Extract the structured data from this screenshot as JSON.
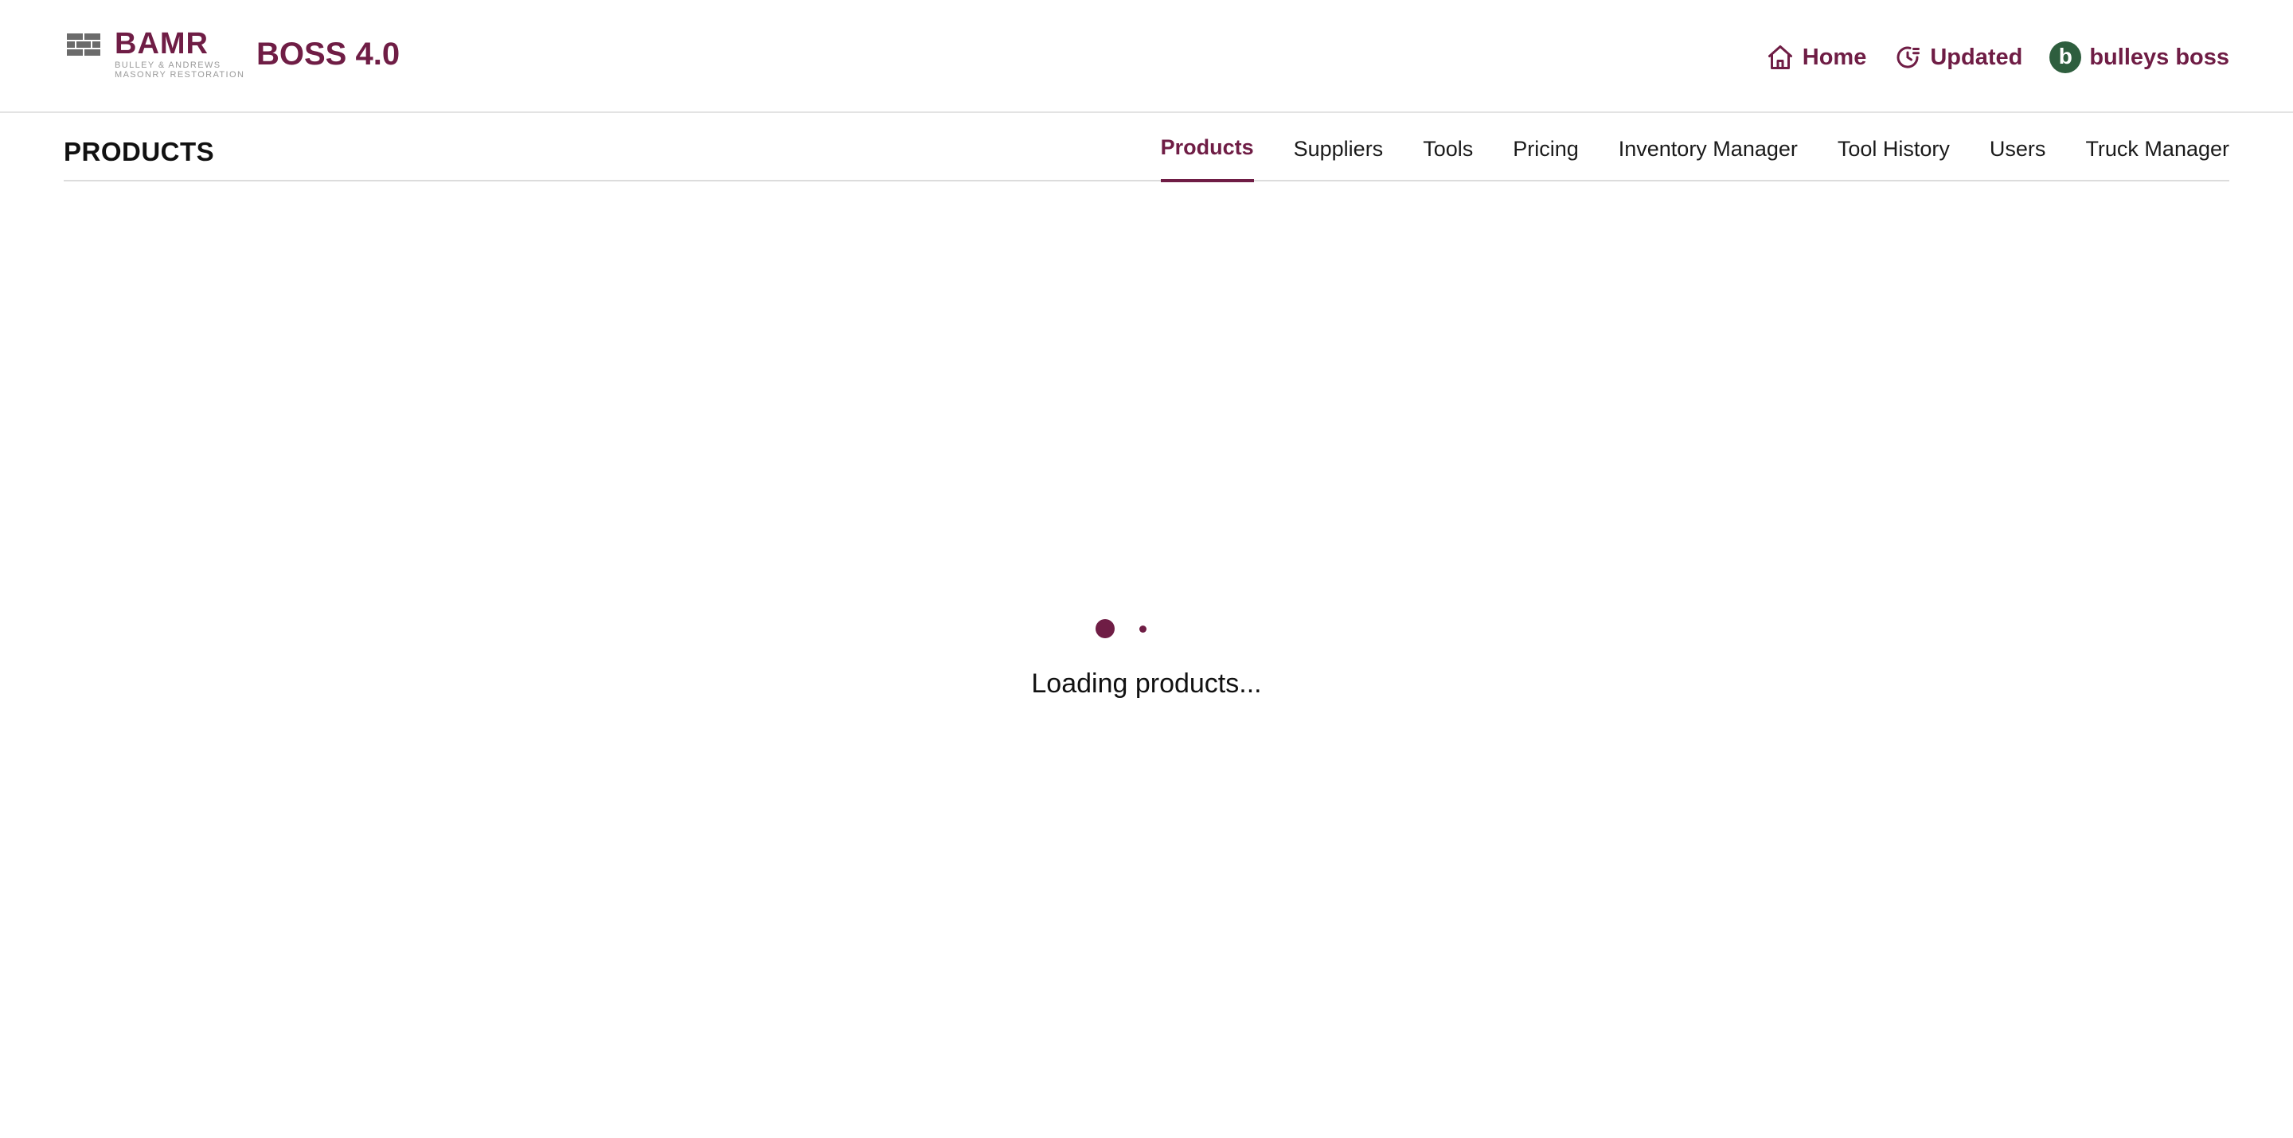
{
  "brand": {
    "logo_word": "BAMR",
    "logo_tagline_line1": "BULLEY & ANDREWS",
    "logo_tagline_line2": "MASONRY RESTORATION",
    "app_title": "BOSS 4.0",
    "accent_color": "#6f1d45",
    "avatar_color": "#2e5e3e"
  },
  "header": {
    "home_label": "Home",
    "home_icon": "home-icon",
    "updated_label": "Updated",
    "updated_icon": "history-clock-icon",
    "user_initial": "b",
    "user_name": "bulleys boss"
  },
  "section": {
    "title": "PRODUCTS",
    "tabs": [
      {
        "label": "Products",
        "active": true
      },
      {
        "label": "Suppliers",
        "active": false
      },
      {
        "label": "Tools",
        "active": false
      },
      {
        "label": "Pricing",
        "active": false
      },
      {
        "label": "Inventory Manager",
        "active": false
      },
      {
        "label": "Tool History",
        "active": false
      },
      {
        "label": "Users",
        "active": false
      },
      {
        "label": "Truck Manager",
        "active": false
      }
    ]
  },
  "loading": {
    "text": "Loading products..."
  }
}
